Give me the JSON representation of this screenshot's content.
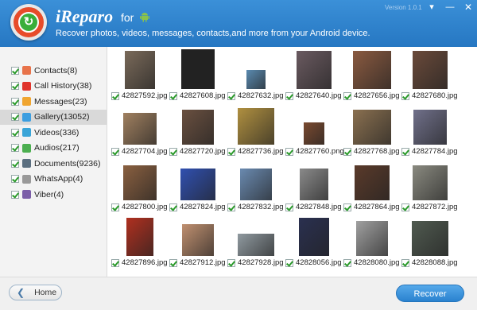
{
  "header": {
    "title": "iReparo",
    "for_label": "for",
    "subtitle": "Recover photos, videos, messages, contacts,and more from your Android device.",
    "version": "Version 1.0.1",
    "menu_icon": "dropdown-arrow-icon",
    "minimize_icon": "minimize-icon",
    "close_icon": "close-icon"
  },
  "sidebar": {
    "items": [
      {
        "label": "Contacts(8)",
        "icon": "contacts-icon",
        "color": "#e8734a",
        "checked": true
      },
      {
        "label": "Call History(38)",
        "icon": "call-history-icon",
        "color": "#e0342c",
        "checked": true
      },
      {
        "label": "Messages(23)",
        "icon": "messages-icon",
        "color": "#f0a530",
        "checked": true
      },
      {
        "label": "Gallery(13052)",
        "icon": "gallery-icon",
        "color": "#3c9ee0",
        "checked": true,
        "selected": true
      },
      {
        "label": "Videos(336)",
        "icon": "videos-icon",
        "color": "#3aa5d8",
        "checked": true
      },
      {
        "label": "Audios(217)",
        "icon": "audios-icon",
        "color": "#4caf50",
        "checked": true
      },
      {
        "label": "Documents(9236)",
        "icon": "documents-icon",
        "color": "#5b6f80",
        "checked": true
      },
      {
        "label": "WhatsApp(4)",
        "icon": "whatsapp-icon",
        "color": "#999999",
        "checked": true
      },
      {
        "label": "Viber(4)",
        "icon": "viber-icon",
        "color": "#7b5ea8",
        "checked": true
      }
    ]
  },
  "gallery": {
    "rows": [
      [
        {
          "name": "42827592.jpg",
          "tone": "#7a6a5a"
        },
        {
          "name": "42827608.jpg",
          "tone": "#222222"
        },
        {
          "name": "42827632.jpg",
          "tone": "#5a8ab0"
        },
        {
          "name": "42827640.jpg",
          "tone": "#6a5a60"
        },
        {
          "name": "42827656.jpg",
          "tone": "#8a5a40"
        },
        {
          "name": "42827680.jpg",
          "tone": "#6a4a3a"
        }
      ],
      [
        {
          "name": "42827704.jpg",
          "tone": "#a08060"
        },
        {
          "name": "42827720.jpg",
          "tone": "#6a5040"
        },
        {
          "name": "42827736.jpg",
          "tone": "#b09040"
        },
        {
          "name": "42827760.png",
          "tone": "#7a4a30"
        },
        {
          "name": "42827768.jpg",
          "tone": "#8a7050"
        },
        {
          "name": "42827784.jpg",
          "tone": "#70708a"
        }
      ],
      [
        {
          "name": "42827800.jpg",
          "tone": "#8a6040"
        },
        {
          "name": "42827824.jpg",
          "tone": "#3050b0"
        },
        {
          "name": "42827832.jpg",
          "tone": "#6a8ab0"
        },
        {
          "name": "42827848.jpg",
          "tone": "#8a8a8a"
        },
        {
          "name": "42827864.jpg",
          "tone": "#5a3a2a"
        },
        {
          "name": "42827872.jpg",
          "tone": "#8a8a80"
        }
      ],
      [
        {
          "name": "42827896.jpg",
          "tone": "#b03020"
        },
        {
          "name": "42827912.jpg",
          "tone": "#c09070"
        },
        {
          "name": "42827928.jpg",
          "tone": "#909aa0"
        },
        {
          "name": "42828056.jpg",
          "tone": "#2a3050"
        },
        {
          "name": "42828080.jpg",
          "tone": "#a0a0a0"
        },
        {
          "name": "42828088.jpg",
          "tone": "#505a50"
        }
      ]
    ]
  },
  "footer": {
    "home_label": "Home",
    "recover_label": "Recover"
  },
  "colors": {
    "header": "#2a7fc9",
    "accent": "#3a8fd8",
    "check": "#2a9a2a"
  }
}
